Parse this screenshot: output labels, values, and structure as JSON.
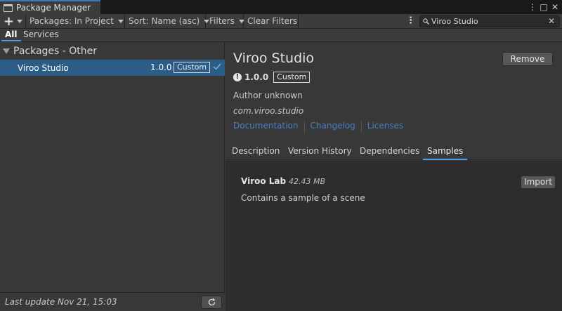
{
  "window": {
    "tab_title": "Package Manager",
    "controls": {
      "menu": "⋮",
      "maximize": "□",
      "close": "✕"
    }
  },
  "toolbar": {
    "add_label": "+",
    "packages_label": "Packages: In Project",
    "sort_label": "Sort: Name (asc)",
    "filters_label": "Filters",
    "clear_filters_label": "Clear Filters",
    "more_label": "⋮",
    "search": {
      "value": "Viroo Studio",
      "clear": "✕"
    }
  },
  "filter_tabs": [
    {
      "label": "All",
      "active": true
    },
    {
      "label": "Services",
      "active": false
    }
  ],
  "package_list": {
    "group_title": "Packages - Other",
    "items": [
      {
        "name": "Viroo Studio",
        "version": "1.0.0",
        "badge": "Custom",
        "selected": true
      }
    ],
    "last_update": "Last update Nov 21, 15:03"
  },
  "details": {
    "title": "Viroo Studio",
    "remove_label": "Remove",
    "version": "1.0.0",
    "badge": "Custom",
    "author": "Author unknown",
    "package_id": "com.viroo.studio",
    "links": [
      "Documentation",
      "Changelog",
      "Licenses"
    ],
    "tabs": [
      {
        "label": "Description",
        "active": false
      },
      {
        "label": "Version History",
        "active": false
      },
      {
        "label": "Dependencies",
        "active": false
      },
      {
        "label": "Samples",
        "active": true
      }
    ],
    "samples": [
      {
        "name": "Viroo Lab",
        "size": "42.43 MB",
        "description": "Contains a sample of a scene",
        "import_label": "Import"
      }
    ]
  },
  "colors": {
    "selection": "#2c5d87",
    "accent": "#4c9ef0",
    "link": "#4c7ec2"
  }
}
